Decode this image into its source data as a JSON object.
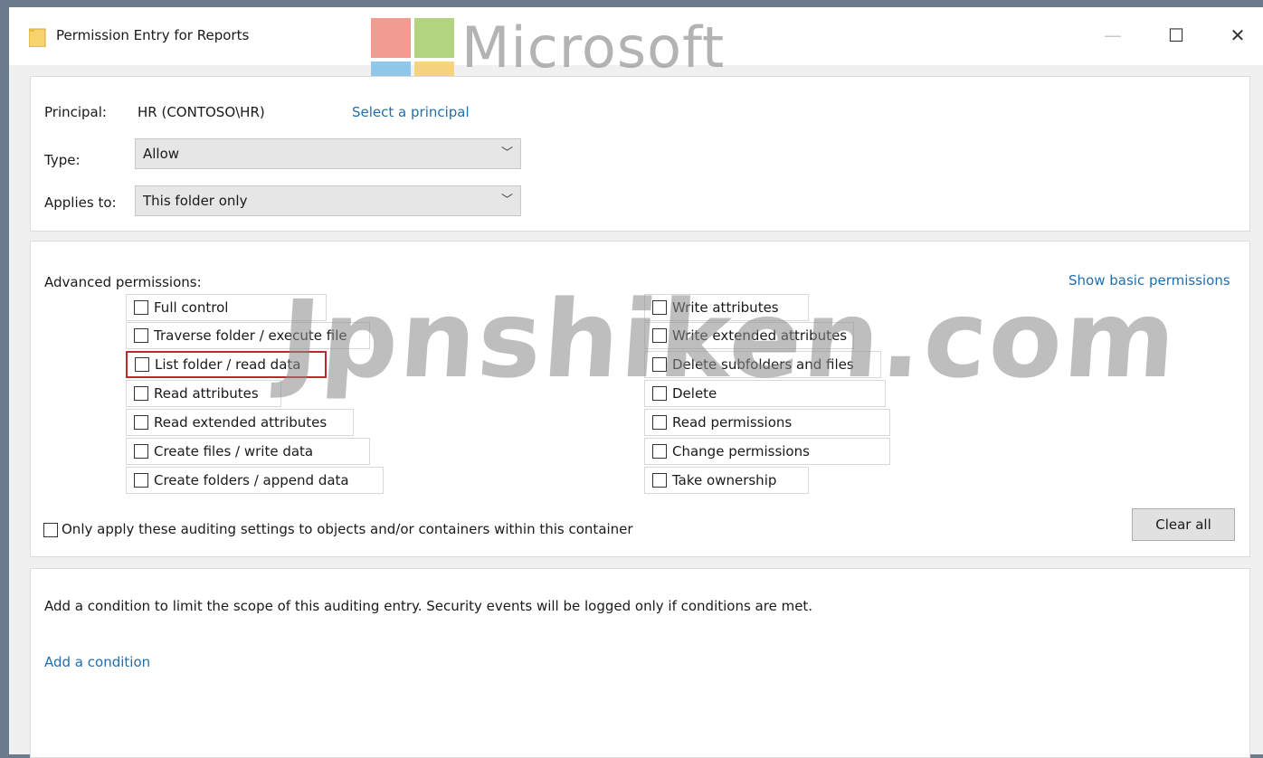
{
  "window": {
    "title": "Permission Entry for Reports",
    "controls": {
      "minimize": "—",
      "maximize": "☐",
      "close": "✕"
    }
  },
  "watermarks": {
    "microsoft": "Microsoft",
    "site": "Jpnshiken.com",
    "logo_colors": [
      "#f25022",
      "#7fba00",
      "#00a4ef",
      "#ffb900"
    ]
  },
  "principal": {
    "label": "Principal:",
    "value": "HR (CONTOSO\\HR)",
    "select_link": "Select a principal"
  },
  "type": {
    "label": "Type:",
    "value": "Allow"
  },
  "applies_to": {
    "label": "Applies to:",
    "value": "This folder only"
  },
  "advanced": {
    "label": "Advanced permissions:",
    "show_basic_link": "Show basic permissions",
    "left": [
      {
        "label": "Full control",
        "checked": false
      },
      {
        "label": "Traverse folder / execute file",
        "checked": false
      },
      {
        "label": "List folder / read data",
        "checked": false,
        "highlighted": true
      },
      {
        "label": "Read attributes",
        "checked": false
      },
      {
        "label": "Read extended attributes",
        "checked": false
      },
      {
        "label": "Create files / write data",
        "checked": false
      },
      {
        "label": "Create folders / append data",
        "checked": false
      }
    ],
    "right": [
      {
        "label": "Write attributes",
        "checked": false
      },
      {
        "label": "Write extended attributes",
        "checked": false
      },
      {
        "label": "Delete subfolders and files",
        "checked": false
      },
      {
        "label": "Delete",
        "checked": false
      },
      {
        "label": "Read permissions",
        "checked": false
      },
      {
        "label": "Change permissions",
        "checked": false
      },
      {
        "label": "Take ownership",
        "checked": false
      }
    ],
    "only_apply": "Only apply these auditing settings to objects and/or containers within this container",
    "clear_all": "Clear all"
  },
  "condition": {
    "description": "Add a condition to limit the scope of this auditing entry. Security events will be logged only if conditions are met.",
    "add_link": "Add a condition"
  },
  "colors": {
    "link": "#1f6fb0",
    "highlight": "#c0282d"
  }
}
